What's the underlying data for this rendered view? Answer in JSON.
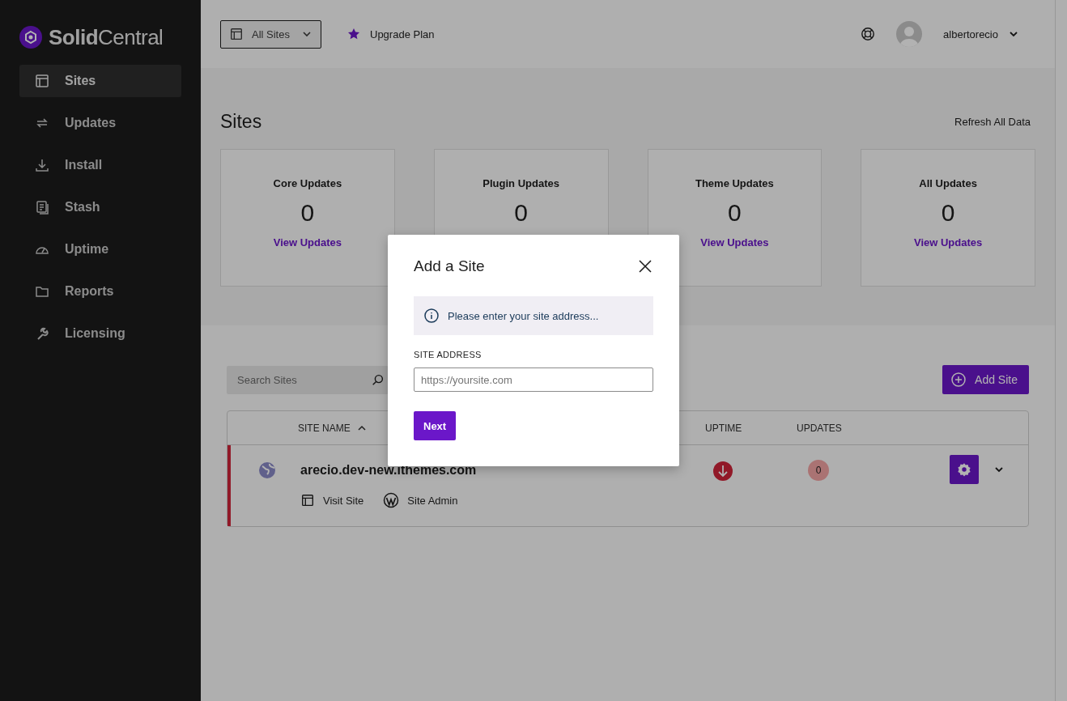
{
  "brand": {
    "name_bold": "Solid",
    "name_light": "Central"
  },
  "sidebar": {
    "items": [
      {
        "label": "Sites",
        "selected": true
      },
      {
        "label": "Updates",
        "selected": false
      },
      {
        "label": "Install",
        "selected": false
      },
      {
        "label": "Stash",
        "selected": false
      },
      {
        "label": "Uptime",
        "selected": false
      },
      {
        "label": "Reports",
        "selected": false
      },
      {
        "label": "Licensing",
        "selected": false
      }
    ]
  },
  "header": {
    "site_selector": "All Sites",
    "upgrade": "Upgrade Plan",
    "username": "albertorecio"
  },
  "page": {
    "title": "Sites",
    "refresh": "Refresh All Data"
  },
  "stats": [
    {
      "title": "Core Updates",
      "count": "0",
      "link": "View Updates"
    },
    {
      "title": "Plugin Updates",
      "count": "0"
    },
    {
      "title": "Theme Updates",
      "count": "0",
      "link": "View Updates"
    },
    {
      "title": "All Updates",
      "count": "0",
      "link": "View Updates"
    }
  ],
  "search": {
    "placeholder": "Search Sites"
  },
  "add_site": "Add Site",
  "table": {
    "columns": [
      {
        "label": "SITE NAME",
        "sorted": true
      },
      {
        "label": "UPTIME",
        "sorted": false
      },
      {
        "label": "UPDATES",
        "sorted": false
      }
    ],
    "rows": [
      {
        "name": "arecio.dev-new.ithemes.com",
        "down": true,
        "updates": "0",
        "visit": "Visit Site",
        "admin": "Site Admin"
      }
    ]
  },
  "modal": {
    "title": "Add a Site",
    "notice": "Please enter your site address...",
    "field_label": "SITE ADDRESS",
    "placeholder": "https://yoursite.com",
    "button": "Next"
  }
}
